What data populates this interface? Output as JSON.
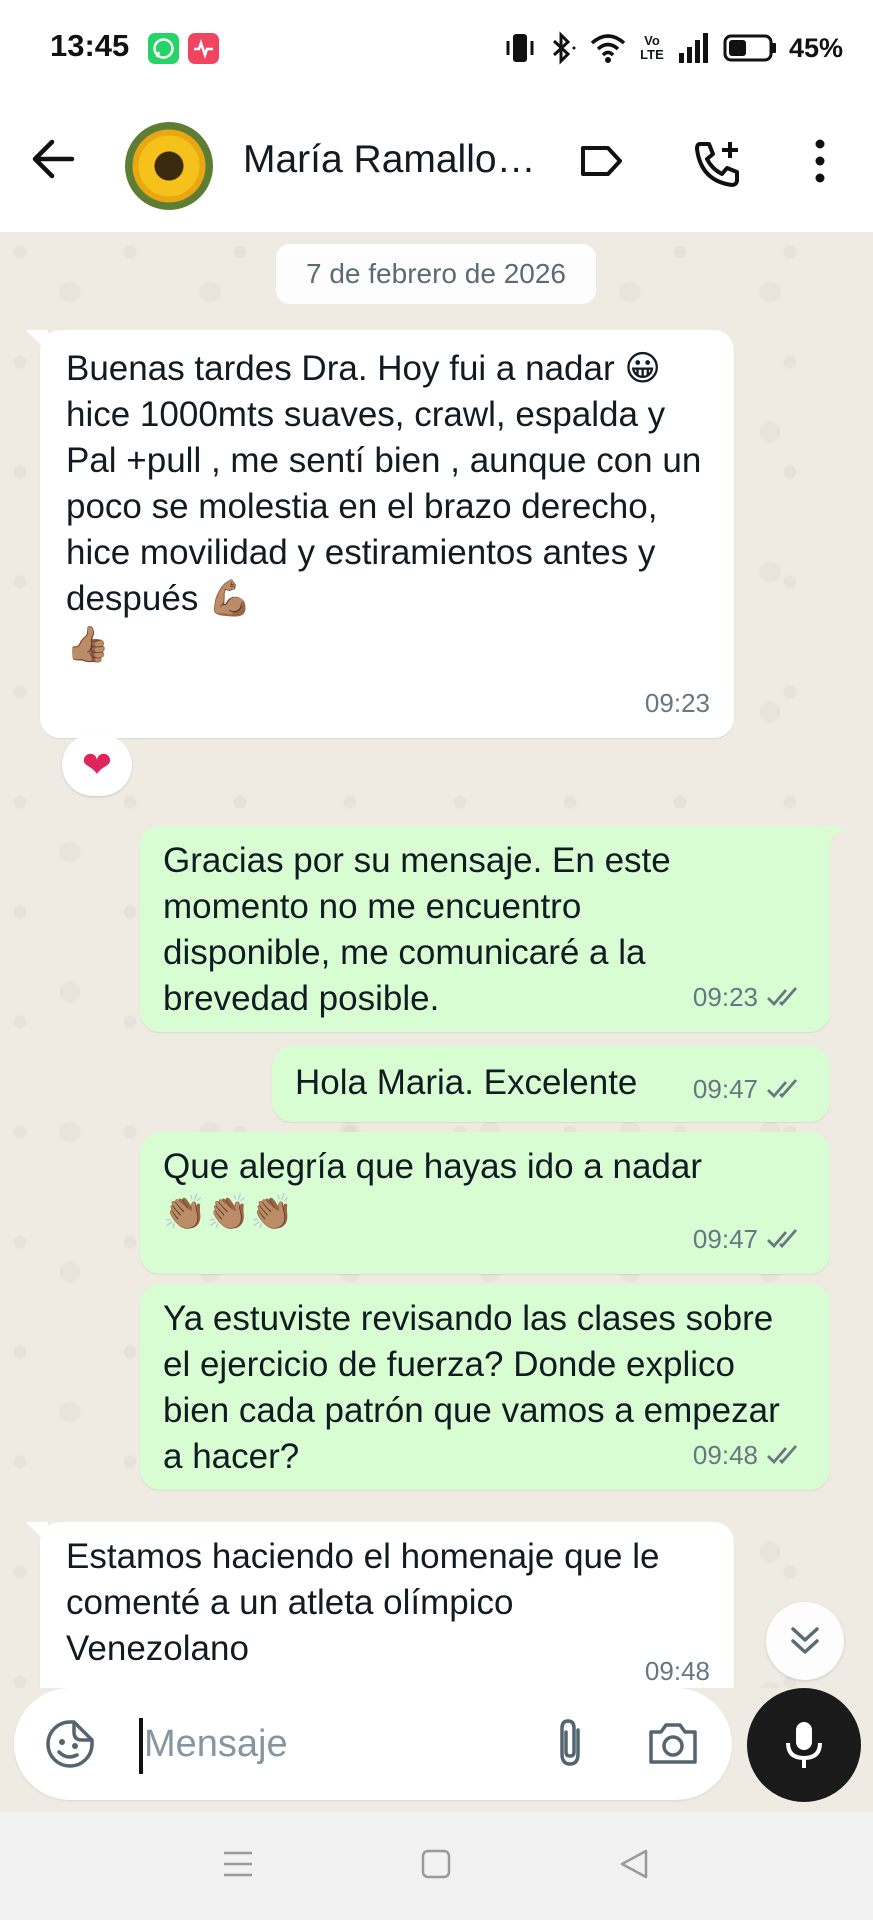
{
  "status_bar": {
    "time": "13:45",
    "network_label": "Vo LTE",
    "battery": "45%",
    "battery_level": 0.45
  },
  "header": {
    "contact_name": "María Ramallo…"
  },
  "chat": {
    "date_chip": "7 de febrero de 2026",
    "messages": [
      {
        "direction": "in",
        "text": "Buenas tardes Dra. Hoy fui a nadar 😀hice 1000mts suaves, crawl, espalda y Pal +pull , me sentí bien , aunque con un poco se molestia en el brazo derecho, hice movilidad y estiramientos antes y después 💪🏽\n👍🏽",
        "time": "09:23",
        "reaction": "❤"
      },
      {
        "direction": "out",
        "text": "Gracias por su mensaje. En este momento no me encuentro disponible, me comunicaré a la brevedad posible.",
        "time": "09:23"
      },
      {
        "direction": "out",
        "text": "Hola Maria. Excelente",
        "time": "09:47"
      },
      {
        "direction": "out",
        "text": "Que alegría que hayas ido a nadar\n👏🏽👏🏽👏🏽",
        "time": "09:47"
      },
      {
        "direction": "out",
        "text": "Ya estuviste revisando las clases sobre el ejercicio de fuerza? Donde explico bien cada patrón que vamos a empezar a hacer?",
        "time": "09:48"
      },
      {
        "direction": "in",
        "text": "Estamos haciendo el homenaje que le comenté a un atleta olímpico Venezolano",
        "time": "09:48"
      }
    ]
  },
  "composer": {
    "placeholder": "Mensaje"
  },
  "colors": {
    "incoming_bubble": "#ffffff",
    "outgoing_bubble": "#d9fdd3",
    "chat_background": "#efeae2",
    "read_ticks": "#667781"
  }
}
